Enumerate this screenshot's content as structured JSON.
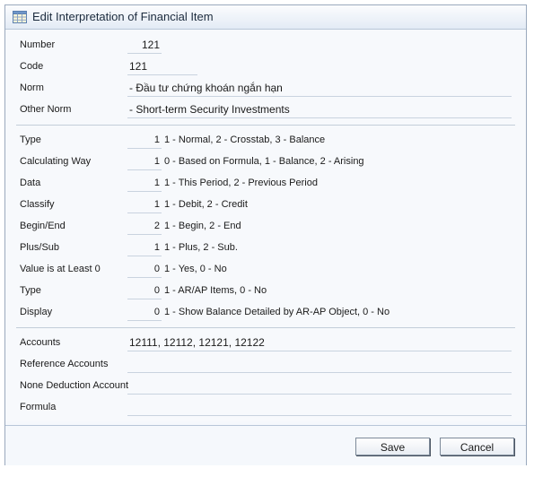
{
  "dialog": {
    "title": "Edit Interpretation of Financial Item"
  },
  "top": {
    "number": {
      "label": "Number",
      "value": "121"
    },
    "code": {
      "label": "Code",
      "value": "121"
    },
    "norm": {
      "label": "Norm",
      "value": "- Đầu tư chứng khoán ngắn hạn"
    },
    "other_norm": {
      "label": "Other Norm",
      "value": "- Short-term Security Investments"
    }
  },
  "params": [
    {
      "label": "Type",
      "value": "1",
      "desc": "1 - Normal, 2 - Crosstab, 3 - Balance"
    },
    {
      "label": "Calculating Way",
      "value": "1",
      "desc": "0 - Based on Formula, 1 - Balance, 2 - Arising"
    },
    {
      "label": "Data",
      "value": "1",
      "desc": "1 - This Period, 2 - Previous Period"
    },
    {
      "label": "Classify",
      "value": "1",
      "desc": "1 - Debit, 2 - Credit"
    },
    {
      "label": "Begin/End",
      "value": "2",
      "desc": "1 - Begin, 2 - End"
    },
    {
      "label": "Plus/Sub",
      "value": "1",
      "desc": "1 - Plus, 2 - Sub."
    },
    {
      "label": "Value is at Least 0",
      "value": "0",
      "desc": "1 - Yes, 0 - No"
    },
    {
      "label": "Type",
      "value": "0",
      "desc": "1 - AR/AP Items, 0 - No"
    },
    {
      "label": "Display",
      "value": "0",
      "desc": "1 - Show Balance Detailed by AR-AP Object, 0 - No"
    }
  ],
  "bottom": {
    "accounts": {
      "label": "Accounts",
      "value": "12111, 12112, 12121, 12122"
    },
    "reference_accounts": {
      "label": "Reference Accounts",
      "value": ""
    },
    "none_deduction": {
      "label": "None Deduction Account",
      "value": ""
    },
    "formula": {
      "label": "Formula",
      "value": ""
    }
  },
  "buttons": {
    "save": "Save",
    "cancel": "Cancel"
  }
}
